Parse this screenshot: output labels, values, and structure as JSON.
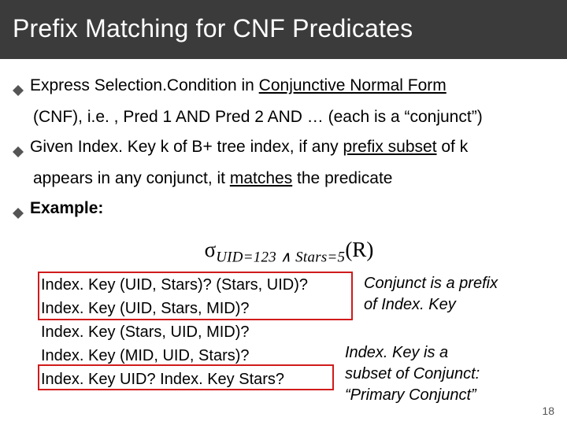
{
  "title": "Prefix Matching for CNF Predicates",
  "bullets": {
    "b1": {
      "pre": "Express Selection.Condition in ",
      "underlined": "Conjunctive Normal Form",
      "cont": "(CNF), i.e. , Pred 1 AND Pred 2 AND … (each is a “conjunct”)"
    },
    "b2": {
      "pre": "Given Index. Key k of B+ tree index, if any ",
      "underlined": "prefix subset",
      "post": " of k",
      "cont_pre": "appears in any conjunct, it ",
      "cont_under": "matches",
      "cont_post": " the predicate"
    },
    "b3": {
      "label": "Example:"
    }
  },
  "formula": {
    "sigma": "σ",
    "subscript": "UID=123 ∧ Stars=5",
    "arg": "(R)"
  },
  "examples": {
    "l1": "Index. Key (UID, Stars)? (Stars, UID)?",
    "l2": "Index. Key (UID, Stars, MID)?",
    "l3": "Index. Key (Stars, UID, MID)?",
    "l4": "Index. Key (MID, UID, Stars)?",
    "l5": "Index. Key UID? Index. Key Stars?"
  },
  "annotations": {
    "a1_l1": "Conjunct is a prefix",
    "a1_l2": "of Index. Key",
    "a2_l1": "Index. Key is a",
    "a2_l2": "subset of Conjunct:",
    "a2_l3": "“Primary Conjunct”"
  },
  "page_number": "18"
}
